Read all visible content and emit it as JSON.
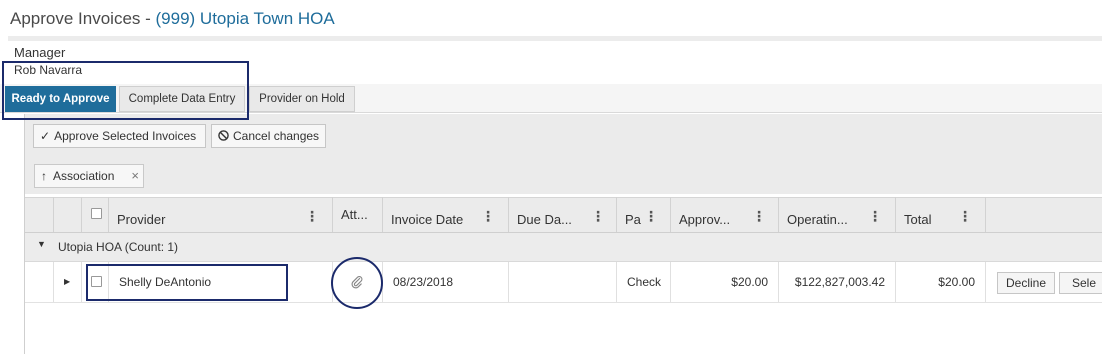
{
  "header": {
    "title_prefix": "Approve Invoices - ",
    "association": "(999) Utopia Town HOA"
  },
  "manager": {
    "label": "Manager",
    "name": "Rob Navarra"
  },
  "tabs": [
    {
      "label": "Ready to Approve",
      "active": true
    },
    {
      "label": "Complete Data Entry",
      "active": false
    },
    {
      "label": "Provider on Hold",
      "active": false
    }
  ],
  "toolbar": {
    "approve_label": "Approve Selected Invoices",
    "cancel_label": "Cancel changes"
  },
  "grouping": {
    "chip_label": "Association",
    "remove_glyph": "×"
  },
  "table": {
    "columns": [
      "Provider",
      "Att...",
      "Invoice Date",
      "Due Da...",
      "Pa",
      "Approv...",
      "Operatin...",
      "Total"
    ],
    "menu_glyph": "⋮",
    "group": {
      "label": "Utopia HOA (Count: 1)"
    },
    "rows": [
      {
        "provider": "Shelly DeAntonio",
        "invoice_date": "08/23/2018",
        "due_date": "",
        "payment": "Check",
        "approved": "$20.00",
        "operating": "$122,827,003.42",
        "total": "$20.00",
        "decline_label": "Decline",
        "select_label": "Sele"
      }
    ]
  },
  "icons": {
    "approve": "check-icon",
    "cancel": "ban-icon",
    "sort": "arrow-up-icon",
    "attachment": "paperclip-icon",
    "expand": "caret-right-icon",
    "collapse": "caret-down-icon"
  },
  "colors": {
    "accent": "#1f6d9b",
    "annotation": "#1b2a6b"
  }
}
